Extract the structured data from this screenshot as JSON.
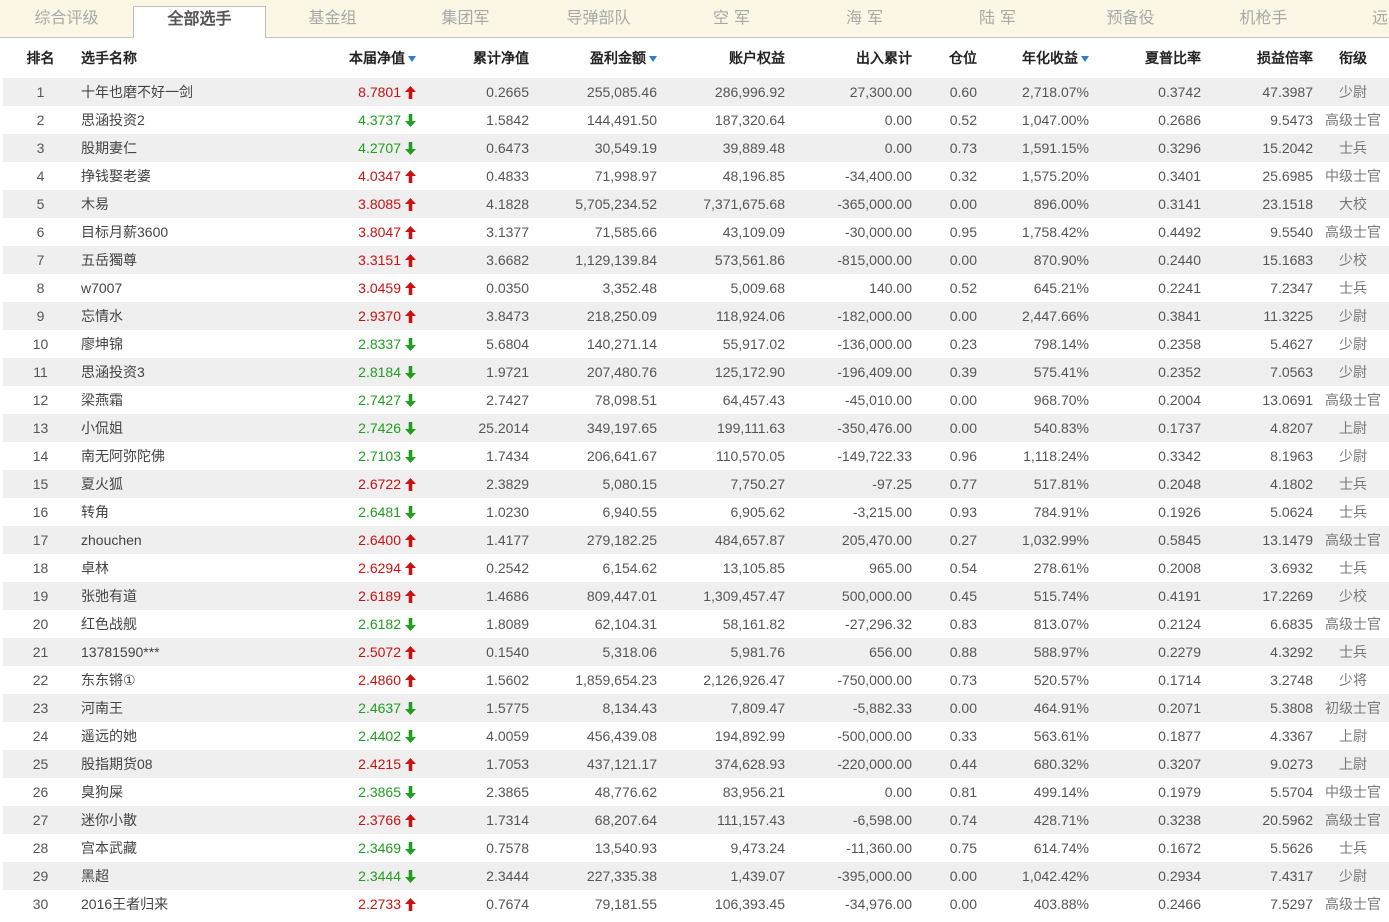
{
  "colors": {
    "tab_bar_bg": "#fbf7e4",
    "row_stripe": "#efefef",
    "up": "#cc1111",
    "down": "#1f9e1f",
    "sort_arrow": "#2d7fd2"
  },
  "tabs": [
    {
      "label": "综合评级"
    },
    {
      "label": "全部选手",
      "active": true
    },
    {
      "label": "基金组"
    },
    {
      "label": "集团军"
    },
    {
      "label": "导弹部队"
    },
    {
      "label": "空 军"
    },
    {
      "label": "海 军"
    },
    {
      "label": "陆 军"
    },
    {
      "label": "预备役"
    },
    {
      "label": "机枪手"
    },
    {
      "label": "远"
    }
  ],
  "table": {
    "columns": {
      "rank": {
        "label": "排名"
      },
      "name": {
        "label": "选手名称"
      },
      "net": {
        "label": "本届净值",
        "sort_icon": "sort-desc-icon"
      },
      "cum": {
        "label": "累计净值"
      },
      "profit": {
        "label": "盈利金额",
        "sort_icon": "sort-desc-icon"
      },
      "equity": {
        "label": "账户权益"
      },
      "flow": {
        "label": "出入累计"
      },
      "position": {
        "label": "仓位"
      },
      "annual": {
        "label": "年化收益",
        "sort_icon": "sort-desc-icon"
      },
      "sharpe": {
        "label": "夏普比率"
      },
      "pl_ratio": {
        "label": "损益倍率"
      },
      "title": {
        "label": "衔级"
      }
    },
    "rows": [
      {
        "rank": "1",
        "name": "十年也磨不好一剑",
        "net": "8.7801",
        "trend_icon": "arrow-up-icon",
        "cum": "0.2665",
        "profit": "255,085.46",
        "equity": "286,996.92",
        "flow": "27,300.00",
        "position": "0.60",
        "annual": "2,718.07%",
        "sharpe": "0.3742",
        "pl_ratio": "47.3987",
        "title": "少尉"
      },
      {
        "rank": "2",
        "name": "思涵投资2",
        "net": "4.3737",
        "trend_icon": "arrow-down-icon",
        "cum": "1.5842",
        "profit": "144,491.50",
        "equity": "187,320.64",
        "flow": "0.00",
        "position": "0.52",
        "annual": "1,047.00%",
        "sharpe": "0.2686",
        "pl_ratio": "9.5473",
        "title": "高级士官"
      },
      {
        "rank": "3",
        "name": "股期妻仁",
        "net": "4.2707",
        "trend_icon": "arrow-down-icon",
        "cum": "0.6473",
        "profit": "30,549.19",
        "equity": "39,889.48",
        "flow": "0.00",
        "position": "0.73",
        "annual": "1,591.15%",
        "sharpe": "0.3296",
        "pl_ratio": "15.2042",
        "title": "士兵"
      },
      {
        "rank": "4",
        "name": "挣钱娶老婆",
        "net": "4.0347",
        "trend_icon": "arrow-up-icon",
        "cum": "0.4833",
        "profit": "71,998.97",
        "equity": "48,196.85",
        "flow": "-34,400.00",
        "position": "0.32",
        "annual": "1,575.20%",
        "sharpe": "0.3401",
        "pl_ratio": "25.6985",
        "title": "中级士官"
      },
      {
        "rank": "5",
        "name": "木易",
        "net": "3.8085",
        "trend_icon": "arrow-up-icon",
        "cum": "4.1828",
        "profit": "5,705,234.52",
        "equity": "7,371,675.68",
        "flow": "-365,000.00",
        "position": "0.00",
        "annual": "896.00%",
        "sharpe": "0.3141",
        "pl_ratio": "23.1518",
        "title": "大校"
      },
      {
        "rank": "6",
        "name": "目标月薪3600",
        "net": "3.8047",
        "trend_icon": "arrow-up-icon",
        "cum": "3.1377",
        "profit": "71,585.66",
        "equity": "43,109.09",
        "flow": "-30,000.00",
        "position": "0.95",
        "annual": "1,758.42%",
        "sharpe": "0.4492",
        "pl_ratio": "9.5540",
        "title": "高级士官"
      },
      {
        "rank": "7",
        "name": "五岳獨尊",
        "net": "3.3151",
        "trend_icon": "arrow-up-icon",
        "cum": "3.6682",
        "profit": "1,129,139.84",
        "equity": "573,561.86",
        "flow": "-815,000.00",
        "position": "0.00",
        "annual": "870.90%",
        "sharpe": "0.2440",
        "pl_ratio": "15.1683",
        "title": "少校"
      },
      {
        "rank": "8",
        "name": "w7007",
        "net": "3.0459",
        "trend_icon": "arrow-up-icon",
        "cum": "0.0350",
        "profit": "3,352.48",
        "equity": "5,009.68",
        "flow": "140.00",
        "position": "0.52",
        "annual": "645.21%",
        "sharpe": "0.2241",
        "pl_ratio": "7.2347",
        "title": "士兵"
      },
      {
        "rank": "9",
        "name": "忘情水",
        "net": "2.9370",
        "trend_icon": "arrow-up-icon",
        "cum": "3.8473",
        "profit": "218,250.09",
        "equity": "118,924.06",
        "flow": "-182,000.00",
        "position": "0.00",
        "annual": "2,447.66%",
        "sharpe": "0.3841",
        "pl_ratio": "11.3225",
        "title": "少尉"
      },
      {
        "rank": "10",
        "name": "廖坤锦",
        "net": "2.8337",
        "trend_icon": "arrow-down-icon",
        "cum": "5.6804",
        "profit": "140,271.14",
        "equity": "55,917.02",
        "flow": "-136,000.00",
        "position": "0.23",
        "annual": "798.14%",
        "sharpe": "0.2358",
        "pl_ratio": "5.4627",
        "title": "少尉"
      },
      {
        "rank": "11",
        "name": "思涵投资3",
        "net": "2.8184",
        "trend_icon": "arrow-down-icon",
        "cum": "1.9721",
        "profit": "207,480.76",
        "equity": "125,172.90",
        "flow": "-196,409.00",
        "position": "0.39",
        "annual": "575.41%",
        "sharpe": "0.2352",
        "pl_ratio": "7.0563",
        "title": "少尉"
      },
      {
        "rank": "12",
        "name": "梁燕霜",
        "net": "2.7427",
        "trend_icon": "arrow-down-icon",
        "cum": "2.7427",
        "profit": "78,098.51",
        "equity": "64,457.43",
        "flow": "-45,010.00",
        "position": "0.00",
        "annual": "968.70%",
        "sharpe": "0.2004",
        "pl_ratio": "13.0691",
        "title": "高级士官"
      },
      {
        "rank": "13",
        "name": "小侃姐",
        "net": "2.7426",
        "trend_icon": "arrow-down-icon",
        "cum": "25.2014",
        "profit": "349,197.65",
        "equity": "199,111.63",
        "flow": "-350,476.00",
        "position": "0.00",
        "annual": "540.83%",
        "sharpe": "0.1737",
        "pl_ratio": "4.8207",
        "title": "上尉"
      },
      {
        "rank": "14",
        "name": "南无阿弥陀佛",
        "net": "2.7103",
        "trend_icon": "arrow-down-icon",
        "cum": "1.7434",
        "profit": "206,641.67",
        "equity": "110,570.05",
        "flow": "-149,722.33",
        "position": "0.96",
        "annual": "1,118.24%",
        "sharpe": "0.3342",
        "pl_ratio": "8.1963",
        "title": "少尉"
      },
      {
        "rank": "15",
        "name": "夏火狐",
        "net": "2.6722",
        "trend_icon": "arrow-up-icon",
        "cum": "2.3829",
        "profit": "5,080.15",
        "equity": "7,750.27",
        "flow": "-97.25",
        "position": "0.77",
        "annual": "517.81%",
        "sharpe": "0.2048",
        "pl_ratio": "4.1802",
        "title": "士兵"
      },
      {
        "rank": "16",
        "name": "转角",
        "net": "2.6481",
        "trend_icon": "arrow-down-icon",
        "cum": "1.0230",
        "profit": "6,940.55",
        "equity": "6,905.62",
        "flow": "-3,215.00",
        "position": "0.93",
        "annual": "784.91%",
        "sharpe": "0.1926",
        "pl_ratio": "5.0624",
        "title": "士兵"
      },
      {
        "rank": "17",
        "name": "zhouchen",
        "net": "2.6400",
        "trend_icon": "arrow-up-icon",
        "cum": "1.4177",
        "profit": "279,182.25",
        "equity": "484,657.87",
        "flow": "205,470.00",
        "position": "0.27",
        "annual": "1,032.99%",
        "sharpe": "0.5845",
        "pl_ratio": "13.1479",
        "title": "高级士官"
      },
      {
        "rank": "18",
        "name": "卓林",
        "net": "2.6294",
        "trend_icon": "arrow-up-icon",
        "cum": "0.2542",
        "profit": "6,154.62",
        "equity": "13,105.85",
        "flow": "965.00",
        "position": "0.54",
        "annual": "278.61%",
        "sharpe": "0.2008",
        "pl_ratio": "3.6932",
        "title": "士兵"
      },
      {
        "rank": "19",
        "name": "张弛有道",
        "net": "2.6189",
        "trend_icon": "arrow-up-icon",
        "cum": "1.4686",
        "profit": "809,447.01",
        "equity": "1,309,457.47",
        "flow": "500,000.00",
        "position": "0.45",
        "annual": "515.74%",
        "sharpe": "0.4191",
        "pl_ratio": "17.2269",
        "title": "少校"
      },
      {
        "rank": "20",
        "name": "红色战舰",
        "net": "2.6182",
        "trend_icon": "arrow-down-icon",
        "cum": "1.8089",
        "profit": "62,104.31",
        "equity": "58,161.82",
        "flow": "-27,296.32",
        "position": "0.83",
        "annual": "813.07%",
        "sharpe": "0.2124",
        "pl_ratio": "6.6835",
        "title": "高级士官"
      },
      {
        "rank": "21",
        "name": "13781590***",
        "net": "2.5072",
        "trend_icon": "arrow-up-icon",
        "cum": "0.1540",
        "profit": "5,318.06",
        "equity": "5,981.76",
        "flow": "656.00",
        "position": "0.88",
        "annual": "588.97%",
        "sharpe": "0.2279",
        "pl_ratio": "4.3292",
        "title": "士兵"
      },
      {
        "rank": "22",
        "name": "东东锵①",
        "net": "2.4860",
        "trend_icon": "arrow-up-icon",
        "cum": "1.5602",
        "profit": "1,859,654.23",
        "equity": "2,126,926.47",
        "flow": "-750,000.00",
        "position": "0.73",
        "annual": "520.57%",
        "sharpe": "0.1714",
        "pl_ratio": "3.2748",
        "title": "少将"
      },
      {
        "rank": "23",
        "name": "河南王",
        "net": "2.4637",
        "trend_icon": "arrow-down-icon",
        "cum": "1.5775",
        "profit": "8,134.43",
        "equity": "7,809.47",
        "flow": "-5,882.33",
        "position": "0.00",
        "annual": "464.91%",
        "sharpe": "0.2071",
        "pl_ratio": "5.3808",
        "title": "初级士官"
      },
      {
        "rank": "24",
        "name": "遥远的她",
        "net": "2.4402",
        "trend_icon": "arrow-down-icon",
        "cum": "4.0059",
        "profit": "456,439.08",
        "equity": "194,892.99",
        "flow": "-500,000.00",
        "position": "0.33",
        "annual": "563.61%",
        "sharpe": "0.1877",
        "pl_ratio": "4.3367",
        "title": "上尉"
      },
      {
        "rank": "25",
        "name": "股指期货08",
        "net": "2.4215",
        "trend_icon": "arrow-up-icon",
        "cum": "1.7053",
        "profit": "437,121.17",
        "equity": "374,628.93",
        "flow": "-220,000.00",
        "position": "0.44",
        "annual": "680.32%",
        "sharpe": "0.3207",
        "pl_ratio": "9.0273",
        "title": "上尉"
      },
      {
        "rank": "26",
        "name": "臭狗屎",
        "net": "2.3865",
        "trend_icon": "arrow-down-icon",
        "cum": "2.3865",
        "profit": "48,776.62",
        "equity": "83,956.21",
        "flow": "0.00",
        "position": "0.81",
        "annual": "499.14%",
        "sharpe": "0.1979",
        "pl_ratio": "5.5704",
        "title": "中级士官"
      },
      {
        "rank": "27",
        "name": "迷你小散",
        "net": "2.3766",
        "trend_icon": "arrow-up-icon",
        "cum": "1.7314",
        "profit": "68,207.64",
        "equity": "111,157.43",
        "flow": "-6,598.00",
        "position": "0.74",
        "annual": "428.71%",
        "sharpe": "0.3238",
        "pl_ratio": "20.5962",
        "title": "高级士官"
      },
      {
        "rank": "28",
        "name": "宫本武藏",
        "net": "2.3469",
        "trend_icon": "arrow-down-icon",
        "cum": "0.7578",
        "profit": "13,540.93",
        "equity": "9,473.24",
        "flow": "-11,360.00",
        "position": "0.75",
        "annual": "614.74%",
        "sharpe": "0.1672",
        "pl_ratio": "5.5626",
        "title": "士兵"
      },
      {
        "rank": "29",
        "name": "黑超",
        "net": "2.3444",
        "trend_icon": "arrow-down-icon",
        "cum": "2.3444",
        "profit": "227,335.38",
        "equity": "1,439.07",
        "flow": "-395,000.00",
        "position": "0.00",
        "annual": "1,042.42%",
        "sharpe": "0.2934",
        "pl_ratio": "7.4317",
        "title": "少尉"
      },
      {
        "rank": "30",
        "name": "2016王者归来",
        "net": "2.2733",
        "trend_icon": "arrow-up-icon",
        "cum": "0.7674",
        "profit": "79,181.55",
        "equity": "106,393.45",
        "flow": "-34,976.00",
        "position": "0.00",
        "annual": "403.88%",
        "sharpe": "0.2466",
        "pl_ratio": "7.5297",
        "title": "高级士官"
      }
    ]
  }
}
